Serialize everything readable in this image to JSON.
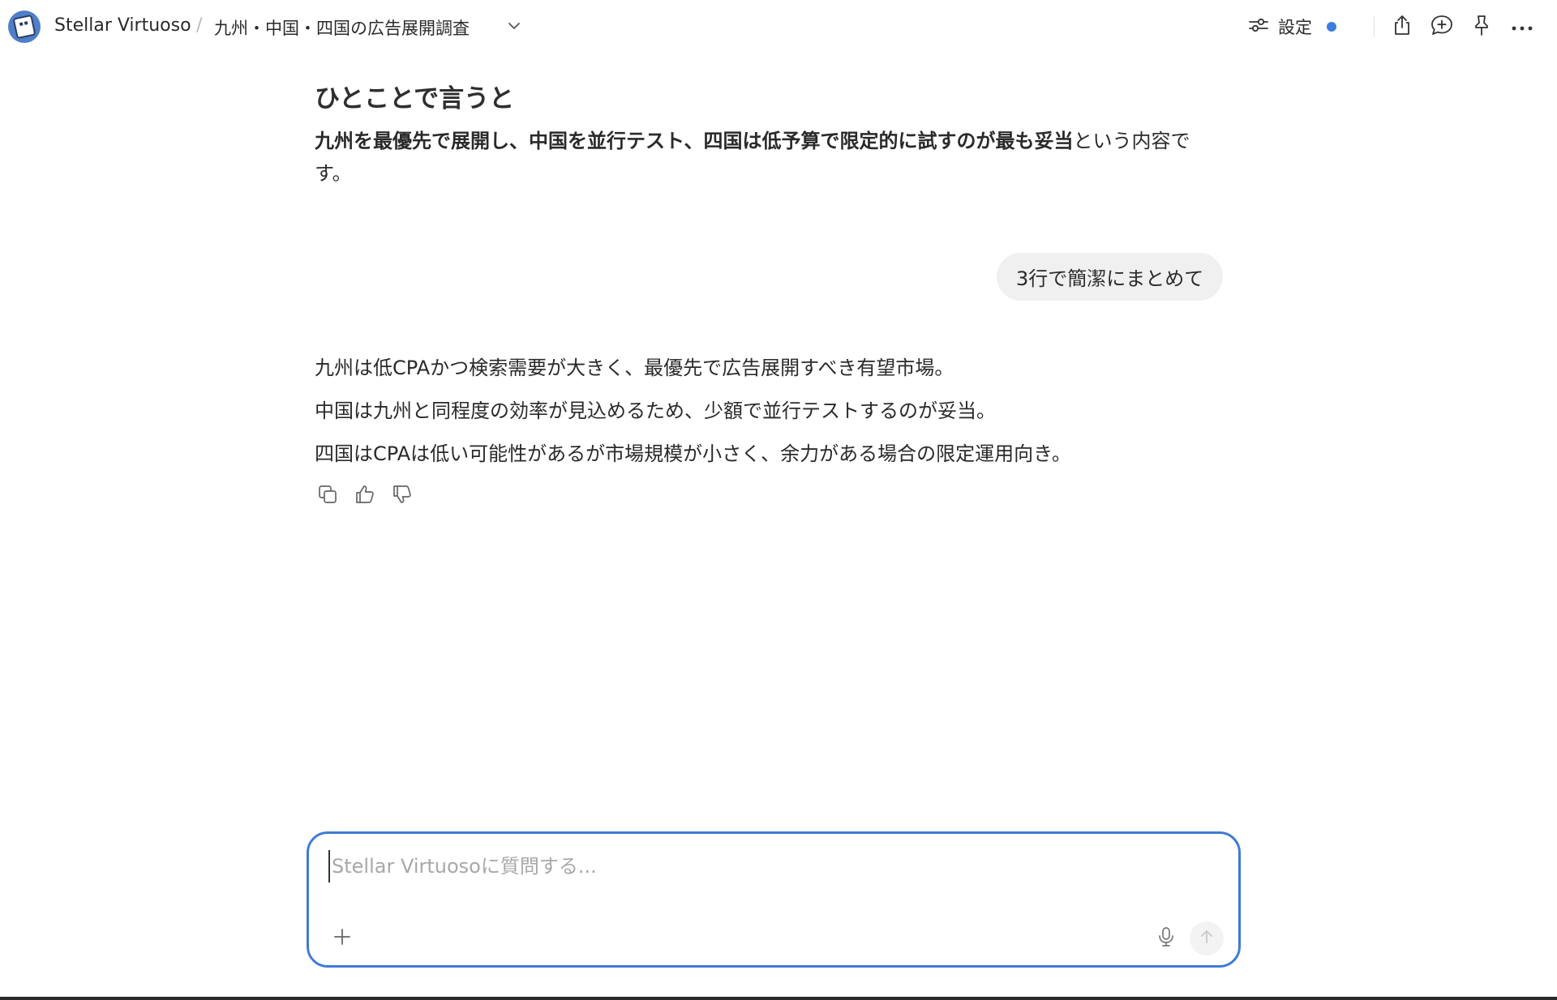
{
  "header": {
    "app_name": "Stellar Virtuoso",
    "separator": "/",
    "thread_title": "九州・中国・四国の広告展開調査",
    "settings_label": "設定"
  },
  "conversation": {
    "summary_heading": "ひとことで言うと",
    "summary_bold": "九州を最優先で展開し、中国を並行テスト、四国は低予算で限定的に試すのが最も妥当",
    "summary_rest": "という内容です。",
    "user_message": "3行で簡潔にまとめて",
    "answer_lines": [
      "九州は低CPAかつ検索需要が大きく、最優先で広告展開すべき有望市場。",
      "中国は九州と同程度の効率が見込めるため、少額で並行テストするのが妥当。",
      "四国はCPAは低い可能性があるが市場規模が小さく、余力がある場合の限定運用向き。"
    ]
  },
  "composer": {
    "value": "",
    "placeholder": "Stellar Virtuosoに質問する..."
  },
  "colors": {
    "accent": "#3f7bd6",
    "status_dot": "#3e7ddc",
    "bubble_bg": "#f0f0f0"
  },
  "icons": {
    "logo": "stellar-virtuoso-logo",
    "chevron": "chevron-down-icon",
    "settings": "sliders-icon",
    "share": "share-icon",
    "comment": "comment-plus-icon",
    "pin": "pin-icon",
    "more": "more-horizontal-icon",
    "copy": "copy-icon",
    "thumbs_up": "thumbs-up-icon",
    "thumbs_down": "thumbs-down-icon",
    "plus": "plus-icon",
    "mic": "microphone-icon",
    "send": "arrow-up-icon"
  }
}
